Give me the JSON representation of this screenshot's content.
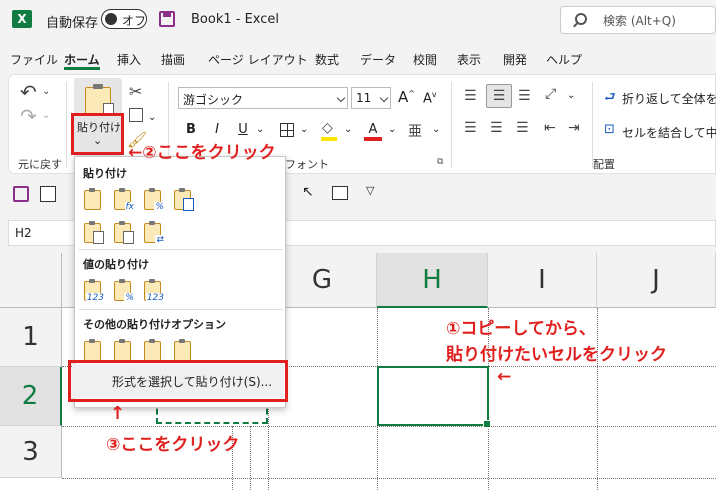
{
  "titlebar": {
    "autosave_label": "自動保存",
    "autosave_state": "オフ",
    "book_title": "Book1  -  Excel",
    "search_placeholder": "検索 (Alt+Q)"
  },
  "menu": [
    "ファイル",
    "ホーム",
    "挿入",
    "描画",
    "ページ レイアウト",
    "数式",
    "データ",
    "校閲",
    "表示",
    "開発",
    "ヘルプ"
  ],
  "menu_active": "ホーム",
  "ribbon": {
    "undo_group_label": "元に戻す",
    "paste_label": "貼り付け",
    "font_name": "游ゴシック",
    "font_size": "11",
    "font_group_label": "フォント",
    "bold": "B",
    "italic": "I",
    "underline": "U",
    "grow": "A",
    "shrink": "A",
    "font_color": "A",
    "wrap_text": "折り返して全体を表",
    "merge_center": "セルを結合して中央",
    "align_group_label": "配置"
  },
  "namebox": "H2",
  "columns": [
    "G",
    "H",
    "I",
    "J"
  ],
  "rows": [
    "1",
    "2",
    "3"
  ],
  "selected_column": "H",
  "selected_row": "2",
  "dropdown": {
    "section_paste": "貼り付け",
    "section_values": "値の貼り付け",
    "section_other": "その他の貼り付けオプション",
    "paste_special": "形式を選択して貼り付け(S)..."
  },
  "annotations": {
    "step1_line1": "①コピーしてから、",
    "step1_line2": "貼り付けたいセルをクリック",
    "step2": "←②ここをクリック",
    "step3": "③ここをクリック",
    "arrow_left": "←",
    "arrow_up": "↑"
  },
  "colors": {
    "accent": "#107c41",
    "annotation": "#e0201e"
  }
}
